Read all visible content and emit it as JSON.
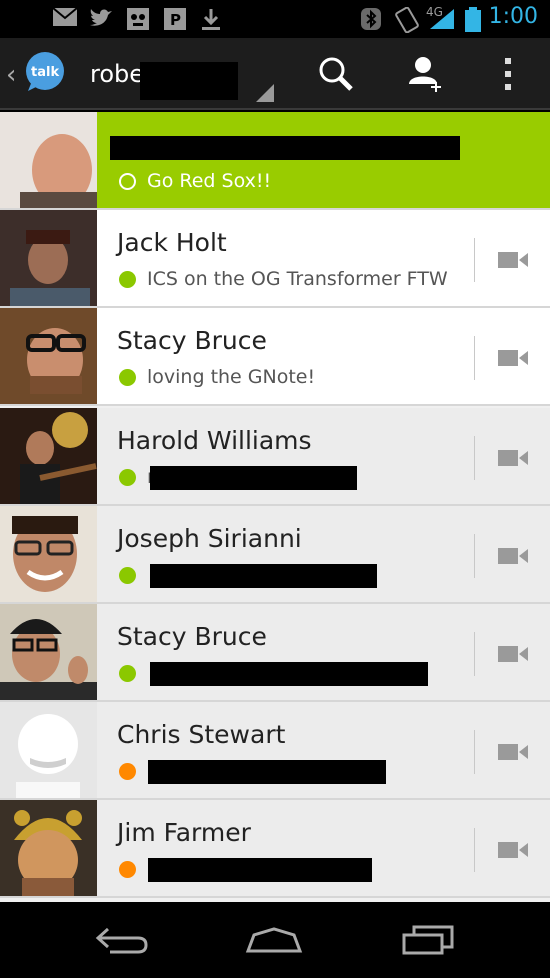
{
  "status_bar": {
    "time": "1:00",
    "network": "4G",
    "icons": [
      "gmail-icon",
      "twitter-icon",
      "robot-icon",
      "pandora-icon",
      "download-icon",
      "bluetooth-icon",
      "rotation-lock-icon",
      "signal-icon",
      "battery-icon"
    ]
  },
  "action_bar": {
    "app": "talk",
    "account": "robe",
    "actions": [
      "search-icon",
      "add-contact-icon",
      "overflow-menu-icon"
    ]
  },
  "contacts": [
    {
      "name": "",
      "status": "Go Red Sox!!",
      "presence": "self",
      "style": "green"
    },
    {
      "name": "Jack Holt",
      "status": "ICS on the OG Transformer FTW",
      "presence": "available",
      "style": "white"
    },
    {
      "name": "Stacy Bruce",
      "status": "loving the GNote!",
      "presence": "available",
      "style": "white"
    },
    {
      "name": "Harold Williams",
      "status": "r",
      "presence": "available",
      "style": "grey"
    },
    {
      "name": "Joseph Sirianni",
      "status": "",
      "presence": "available",
      "style": "grey"
    },
    {
      "name": "Stacy Bruce",
      "status": "",
      "presence": "available",
      "style": "grey"
    },
    {
      "name": "Chris Stewart",
      "status": "",
      "presence": "idle",
      "style": "grey"
    },
    {
      "name": "Jim Farmer",
      "status": "",
      "presence": "idle",
      "style": "grey"
    }
  ],
  "colors": {
    "accent": "#99cc00",
    "available": "#8bc800",
    "idle": "#ff8800",
    "clock": "#33b5e5"
  },
  "nav": [
    "back-icon",
    "home-icon",
    "recent-apps-icon"
  ]
}
